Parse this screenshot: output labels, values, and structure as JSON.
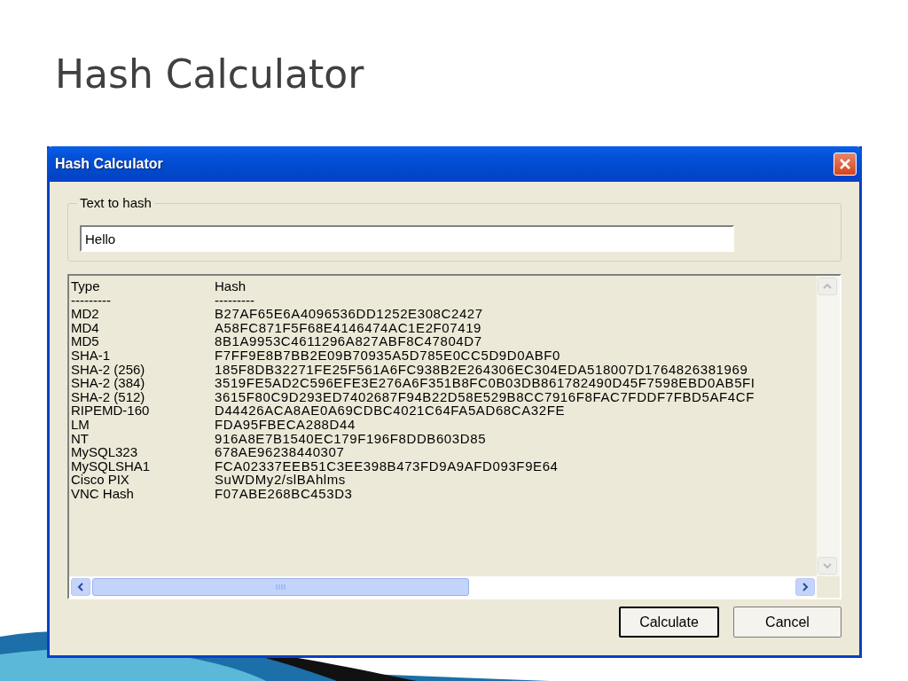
{
  "slide_title": "Hash Calculator",
  "window": {
    "title": "Hash Calculator"
  },
  "text_group": {
    "label": "Text to hash",
    "value": "Hello"
  },
  "output": {
    "header": {
      "type": "Type",
      "hash": "Hash"
    },
    "separator": {
      "type": "---------",
      "hash": "---------"
    },
    "rows": [
      {
        "type": "MD2",
        "hash": "B27AF65E6A4096536DD1252E308C2427"
      },
      {
        "type": "MD4",
        "hash": "A58FC871F5F68E4146474AC1E2F07419"
      },
      {
        "type": "MD5",
        "hash": "8B1A9953C4611296A827ABF8C47804D7"
      },
      {
        "type": "SHA-1",
        "hash": "F7FF9E8B7BB2E09B70935A5D785E0CC5D9D0ABF0"
      },
      {
        "type": "SHA-2 (256)",
        "hash": "185F8DB32271FE25F561A6FC938B2E264306EC304EDA518007D1764826381969"
      },
      {
        "type": "SHA-2 (384)",
        "hash": "3519FE5AD2C596EFE3E276A6F351B8FC0B03DB861782490D45F7598EBD0AB5FI"
      },
      {
        "type": "SHA-2 (512)",
        "hash": "3615F80C9D293ED7402687F94B22D58E529B8CC7916F8FAC7FDDF7FBD5AF4CF"
      },
      {
        "type": "RIPEMD-160",
        "hash": "D44426ACA8AE0A69CDBC4021C64FA5AD68CA32FE"
      },
      {
        "type": "LM",
        "hash": "FDA95FBECA288D44"
      },
      {
        "type": "NT",
        "hash": "916A8E7B1540EC179F196F8DDB603D85"
      },
      {
        "type": "MySQL323",
        "hash": "678AE96238440307"
      },
      {
        "type": "MySQLSHA1",
        "hash": "FCA02337EEB51C3EE398B473FD9A9AFD093F9E64"
      },
      {
        "type": "Cisco PIX",
        "hash": "SuWDMy2/slBAhlms"
      },
      {
        "type": "VNC Hash",
        "hash": "F07ABE268BC453D3"
      }
    ]
  },
  "buttons": [
    {
      "label": "Calculate",
      "default": true
    },
    {
      "label": "Cancel",
      "default": false
    }
  ]
}
